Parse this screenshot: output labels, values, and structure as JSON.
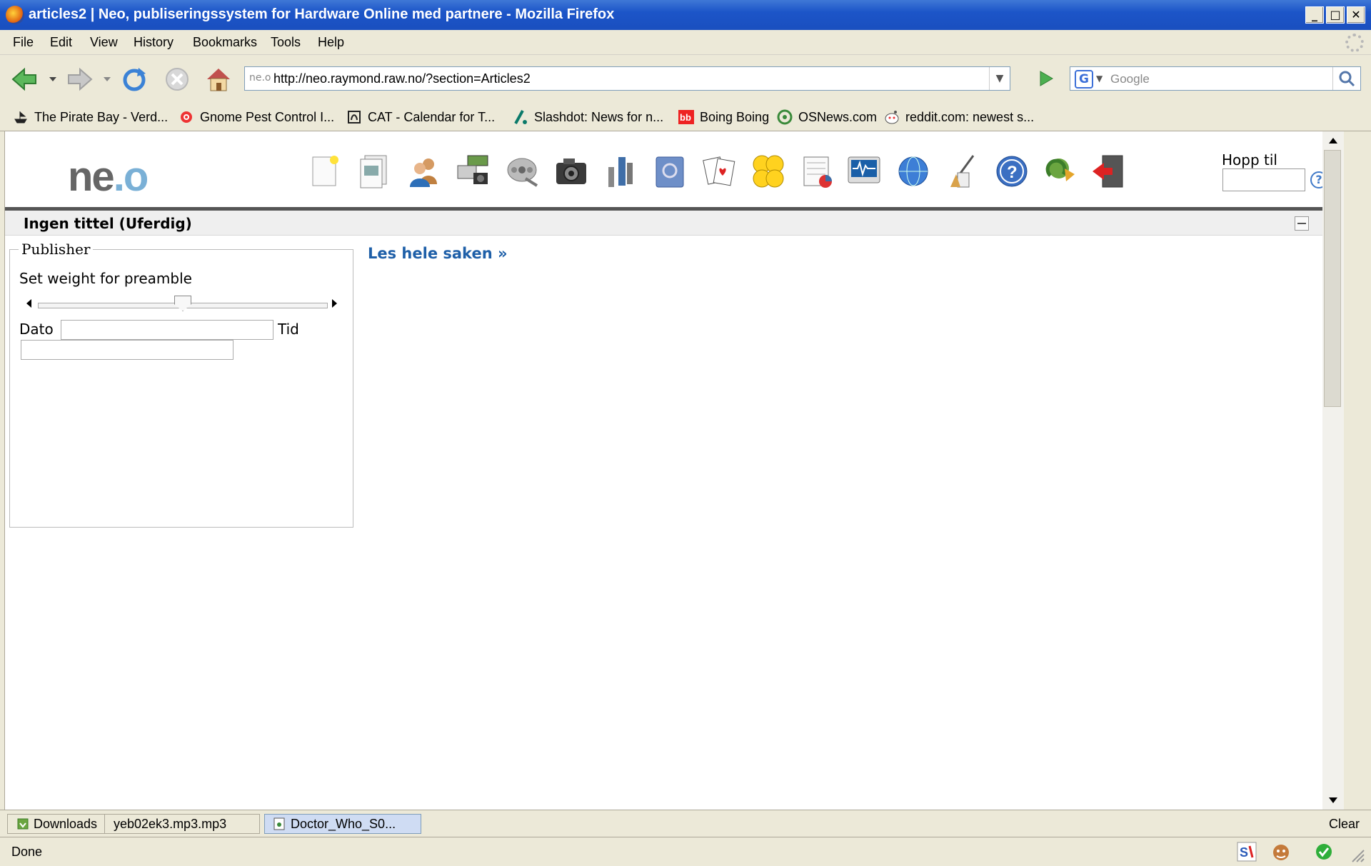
{
  "window": {
    "title": "articles2 | Neo, publiseringssystem for Hardware Online med partnere - Mozilla Firefox",
    "controls": {
      "minimize": "_",
      "maximize": "□",
      "close": "✕"
    }
  },
  "menu": [
    "File",
    "Edit",
    "View",
    "History",
    "Bookmarks",
    "Tools",
    "Help"
  ],
  "nav": {
    "url": "http://neo.raymond.raw.no/?section=Articles2",
    "site_icon_text": "ne.o",
    "search_placeholder": "Google",
    "search_engine_letter": "G"
  },
  "bookmarks": [
    {
      "label": "The Pirate Bay - Verd...",
      "icon": "pirate-ship-icon"
    },
    {
      "label": "Gnome Pest Control I...",
      "icon": "bug-icon"
    },
    {
      "label": "CAT - Calendar for T...",
      "icon": "cat-calendar-icon"
    },
    {
      "label": "Slashdot: News for n...",
      "icon": "slashdot-icon"
    },
    {
      "label": "Boing Boing",
      "icon": "boingboing-icon"
    },
    {
      "label": "OSNews.com",
      "icon": "osnews-icon"
    },
    {
      "label": "reddit.com: newest s...",
      "icon": "reddit-icon"
    }
  ],
  "app": {
    "logo_main": "ne",
    "logo_dot": ".",
    "logo_o": "o",
    "toolbar_icons": [
      "new-document-icon",
      "articles-icon",
      "users-icon",
      "hardware-icon",
      "film-reel-icon",
      "camera-icon",
      "tools-icon",
      "address-book-icon",
      "cards-icon",
      "smileys-icon",
      "calendar-chart-icon",
      "monitor-icon",
      "globe-icon",
      "paint-tools-icon",
      "help-icon",
      "refresh-icon",
      "logout-icon"
    ],
    "jump_label": "Hopp til",
    "jump_help": "?",
    "panel_title": "Ingen tittel (Uferdig)",
    "publisher": {
      "legend": "Publisher",
      "weight_label": "Set weight for preamble",
      "weight_value": 0.5,
      "date_label": "Dato",
      "time_label": "Tid",
      "date_value": "",
      "time_value": ""
    },
    "read_more": "Les hele saken »"
  },
  "downloads": {
    "label": "Downloads",
    "items": [
      "yeb02ek3.mp3.mp3",
      "Doctor_Who_S0..."
    ],
    "clear": "Clear"
  },
  "status": {
    "text": "Done"
  },
  "colors": {
    "link": "#1e5fa8",
    "titlebar": "#1c55c8",
    "chrome": "#ece9d8"
  }
}
